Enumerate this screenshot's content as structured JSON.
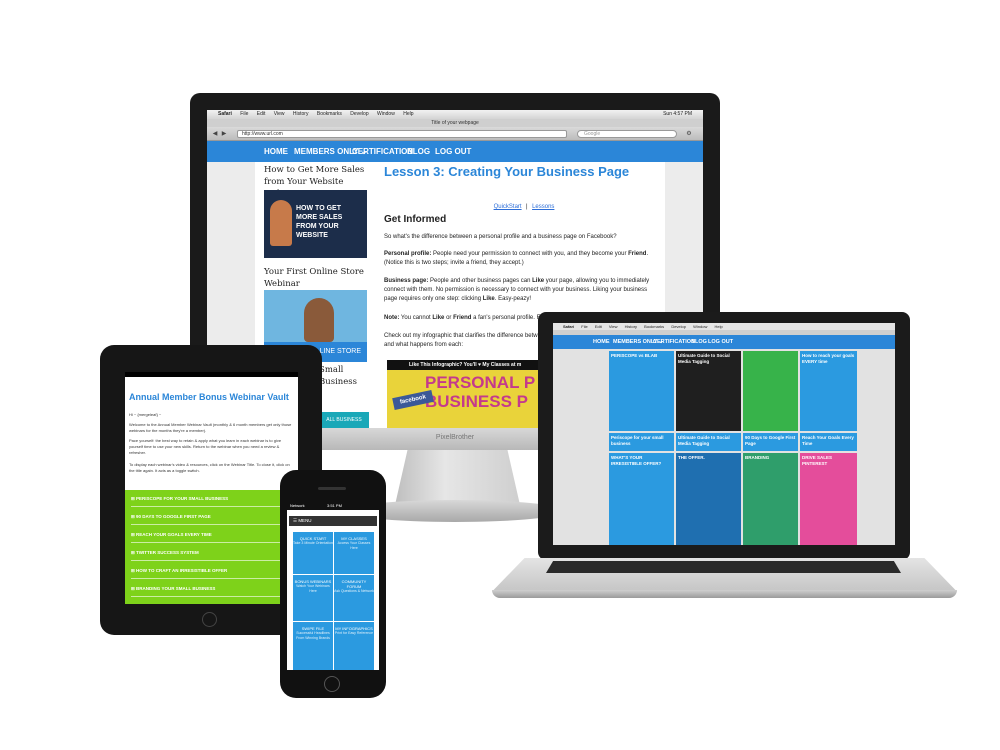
{
  "desktop": {
    "brand": "PixelBrother",
    "menubar": [
      "Safari",
      "File",
      "Edit",
      "View",
      "History",
      "Bookmarks",
      "Develop",
      "Window",
      "Help"
    ],
    "clock": "Sun 4:57 PM",
    "window_title": "Title of your webpage",
    "url": "http://www.url.com",
    "search_placeholder": "Google",
    "nav": [
      "HOME",
      "MEMBERS ONLY ⌄",
      "CERTIFICATION",
      "BLOG",
      "LOG OUT"
    ],
    "sidebar": {
      "item1_title": "How to Get More Sales from Your Website Webinar",
      "item1_banner": "HOW TO GET MORE SALES FROM YOUR WEBSITE",
      "item2_title": "Your First Online Store Webinar",
      "item2_banner": "LINE STORE",
      "item3_title": "Small Business",
      "item3_banner": "ALL BUSINESS"
    },
    "main": {
      "lesson_title": "Lesson 3: Creating Your Business Page",
      "link_quickstart": "QuickStart",
      "link_sep": "|",
      "link_lessons": "Lessons",
      "heading": "Get Informed",
      "intro": "So what's the difference between a personal profile and a business page on Facebook?",
      "p1_label": "Personal profile:",
      "p1_text": " People need your permission to connect with you, and they become your ",
      "p1_bold": "Friend",
      "p1_after": ". (Notice this is two steps; invite a friend, they accept.)",
      "p2_label": "Business page:",
      "p2_text": " People and other business pages can ",
      "p2_bold1": "Like",
      "p2_text2": " your page, allowing you to immediately connect with them. No permission is necessary to connect with your business. Liking your business page requires only one step: clicking ",
      "p2_bold2": "Like",
      "p2_after": ". Easy-peazy!",
      "note_label": "Note:",
      "note_text": " You cannot ",
      "note_b1": "Like",
      "note_text2": " or ",
      "note_b2": "Friend",
      "note_text3": " a fan's personal profile. F",
      "p3": "Check out my infographic that clarifies the difference betwe and what happens from each:",
      "infographic_header": "Like This Infographic? You'll ♥ My Classes at m",
      "infographic_line1": "PERSONAL P",
      "infographic_line2": "BUSINESS P",
      "infographic_badge": "facebook"
    }
  },
  "laptop": {
    "menubar": [
      "Safari",
      "File",
      "Edit",
      "View",
      "History",
      "Bookmarks",
      "Develop",
      "Window",
      "Help"
    ],
    "nav": [
      "HOME",
      "MEMBERS ONLY ⌄",
      "CERTIFICATION",
      "BLOG",
      "LOG OUT"
    ],
    "tiles": [
      {
        "title": "PERISCOPE vs BLAB",
        "color": "#2b9ae0"
      },
      {
        "title": "Ultimate Guide to Social Media Tagging",
        "color": "#1f1f1f"
      },
      {
        "title": "",
        "color": "#37b34a"
      },
      {
        "title": "How to reach your goals EVERY time",
        "color": "#2b9ae0"
      },
      {
        "title": "Periscope for your small business",
        "color": "#2b9ae0"
      },
      {
        "title": "Ultimate Guide to Social Media Tagging",
        "color": "#2b9ae0"
      },
      {
        "title": "90 Days to Google First Page",
        "color": "#2b9ae0"
      },
      {
        "title": "Reach Your Goals Every Time",
        "color": "#2b9ae0"
      },
      {
        "title": "WHAT'S YOUR IRRESISTIBLE OFFER?",
        "color": "#2b9ae0"
      },
      {
        "title": "THE OFFER.",
        "color": "#1f6fb0"
      },
      {
        "title": "BRANDING",
        "color": "#2f9e6b"
      },
      {
        "title": "DRIVE SALES PINTEREST",
        "color": "#e44d9b"
      }
    ]
  },
  "tablet": {
    "title": "Annual Member Bonus Webinar Vault",
    "greeting": "Hi ~ {mergeleaf} ~",
    "p1": "Welcome to the Annual Member Webinar Vault (monthly & 6 month members get only those webinars for the months they're a member).",
    "p2": "Pace yourself: the best way to retain & apply what you learn in each webinar is to give yourself time to use your new skills. Return to the webinar when you need a review & refresher.",
    "p3": "To display each webinar's video & resources, click on the Webinar Title. To close it, click on the title again. It acts as a toggle switch.",
    "items": [
      "PERISCOPE FOR YOUR SMALL BUSINESS",
      "90 DAYS TO GOOGLE FIRST PAGE",
      "REACH YOUR GOALS EVERY TIME",
      "TWITTER SUCCESS SYSTEM",
      "HOW TO CRAFT AN IRRESISTIBLE OFFER",
      "BRANDING YOUR SMALL BUSINESS"
    ]
  },
  "phone": {
    "carrier": "Network",
    "time": "3:51 PM",
    "menu_label": "MENU",
    "tiles": [
      {
        "title": "QUICK START",
        "sub": "Take 3 Minute Orientation"
      },
      {
        "title": "MY CLASSES",
        "sub": "Access Your Classes Here"
      },
      {
        "title": "BONUS WEBINARS",
        "sub": "Watch Your Webinars Here"
      },
      {
        "title": "COMMUNITY FORUM",
        "sub": "Ask Questions & Network"
      },
      {
        "title": "SWIPE FILE",
        "sub": "Successful Headlines From Winning Brands"
      },
      {
        "title": "MY INFOGRAPHICS",
        "sub": "Print for Easy Reference"
      }
    ]
  }
}
